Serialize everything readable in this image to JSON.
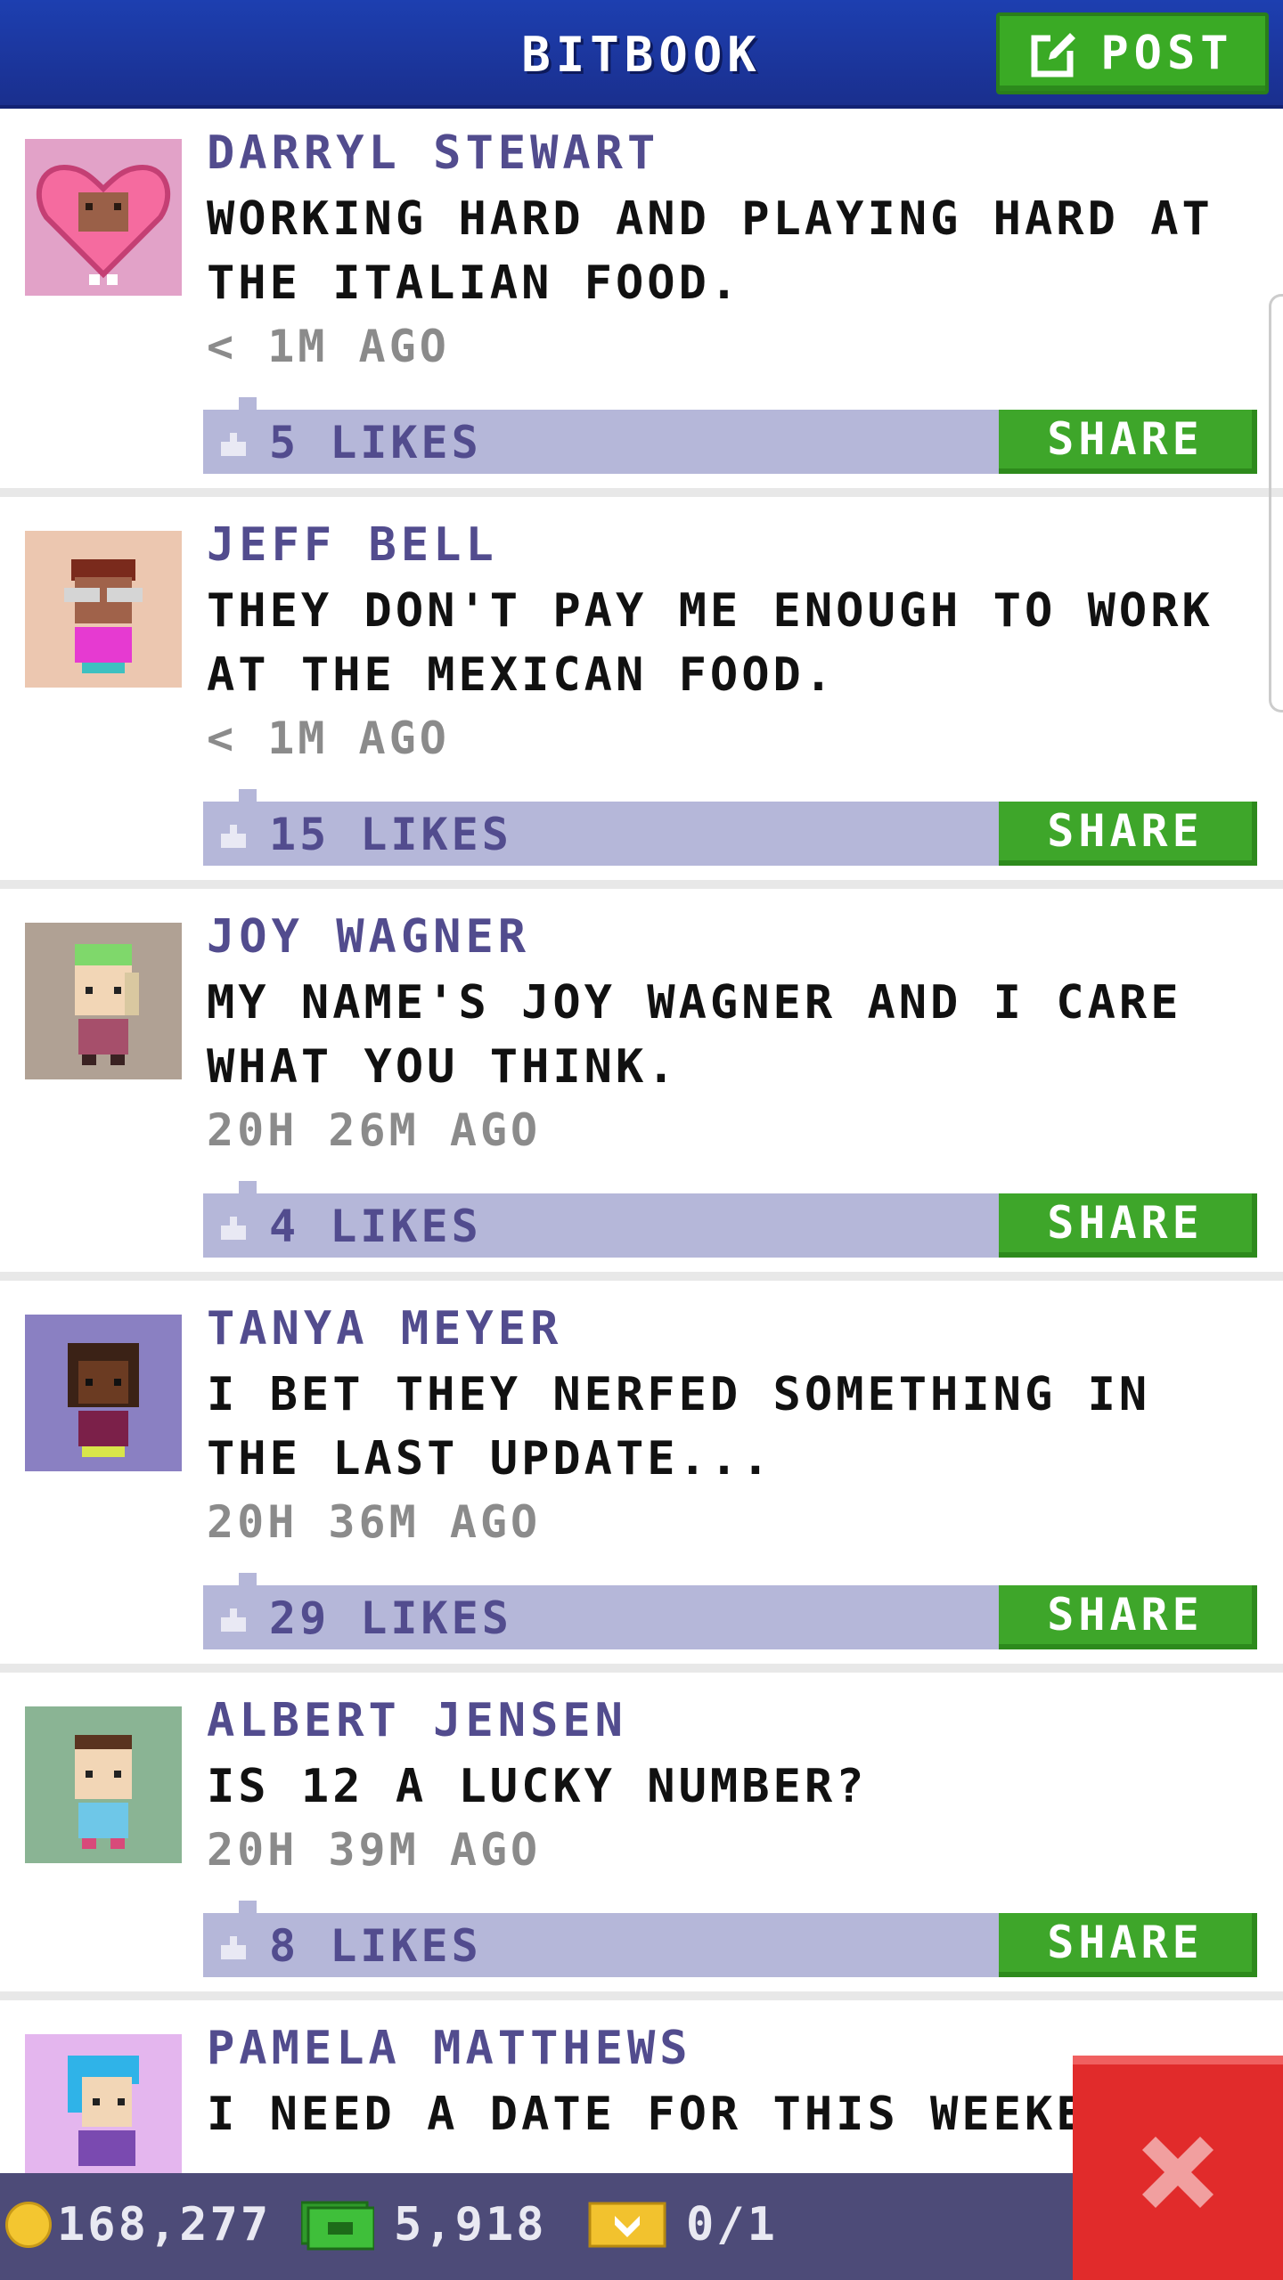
{
  "header": {
    "title": "BITBOOK",
    "post_label": "POST"
  },
  "posts": [
    {
      "author": "DARRYL STEWART",
      "message": "WORKING HARD AND PLAYING HARD AT THE ITALIAN FOOD.",
      "time": "< 1M AGO",
      "likes": "5 LIKES",
      "share": "SHARE",
      "avatar_bg": "#e2a2c8"
    },
    {
      "author": "JEFF BELL",
      "message": "THEY DON'T PAY ME ENOUGH TO WORK AT THE MEXICAN FOOD.",
      "time": "< 1M AGO",
      "likes": "15 LIKES",
      "share": "SHARE",
      "avatar_bg": "#ecc7b0"
    },
    {
      "author": "JOY WAGNER",
      "message": "MY NAME'S JOY WAGNER AND I CARE WHAT YOU THINK.",
      "time": "20H 26M AGO",
      "likes": "4 LIKES",
      "share": "SHARE",
      "avatar_bg": "#b0a194"
    },
    {
      "author": "TANYA MEYER",
      "message": "I BET THEY NERFED SOMETHING IN THE LAST UPDATE...",
      "time": "20H 36M AGO",
      "likes": "29 LIKES",
      "share": "SHARE",
      "avatar_bg": "#8a80c2"
    },
    {
      "author": "ALBERT JENSEN",
      "message": "IS 12 A LUCKY NUMBER?",
      "time": "20H 39M AGO",
      "likes": "8 LIKES",
      "share": "SHARE",
      "avatar_bg": "#8ab494"
    },
    {
      "author": "PAMELA MATTHEWS",
      "message": "I NEED A DATE FOR THIS WEEKEN",
      "time": "",
      "likes": "",
      "share": "",
      "avatar_bg": "#e4b6ee"
    }
  ],
  "footer": {
    "coins": "168,277",
    "bux": "5,918",
    "tickets": "0/1"
  },
  "colors": {
    "header": "#1d3fb0",
    "accent_green": "#3ea62a",
    "likes_bar": "#b5b7d9",
    "author": "#524c8e",
    "close": "#e12b2b"
  }
}
